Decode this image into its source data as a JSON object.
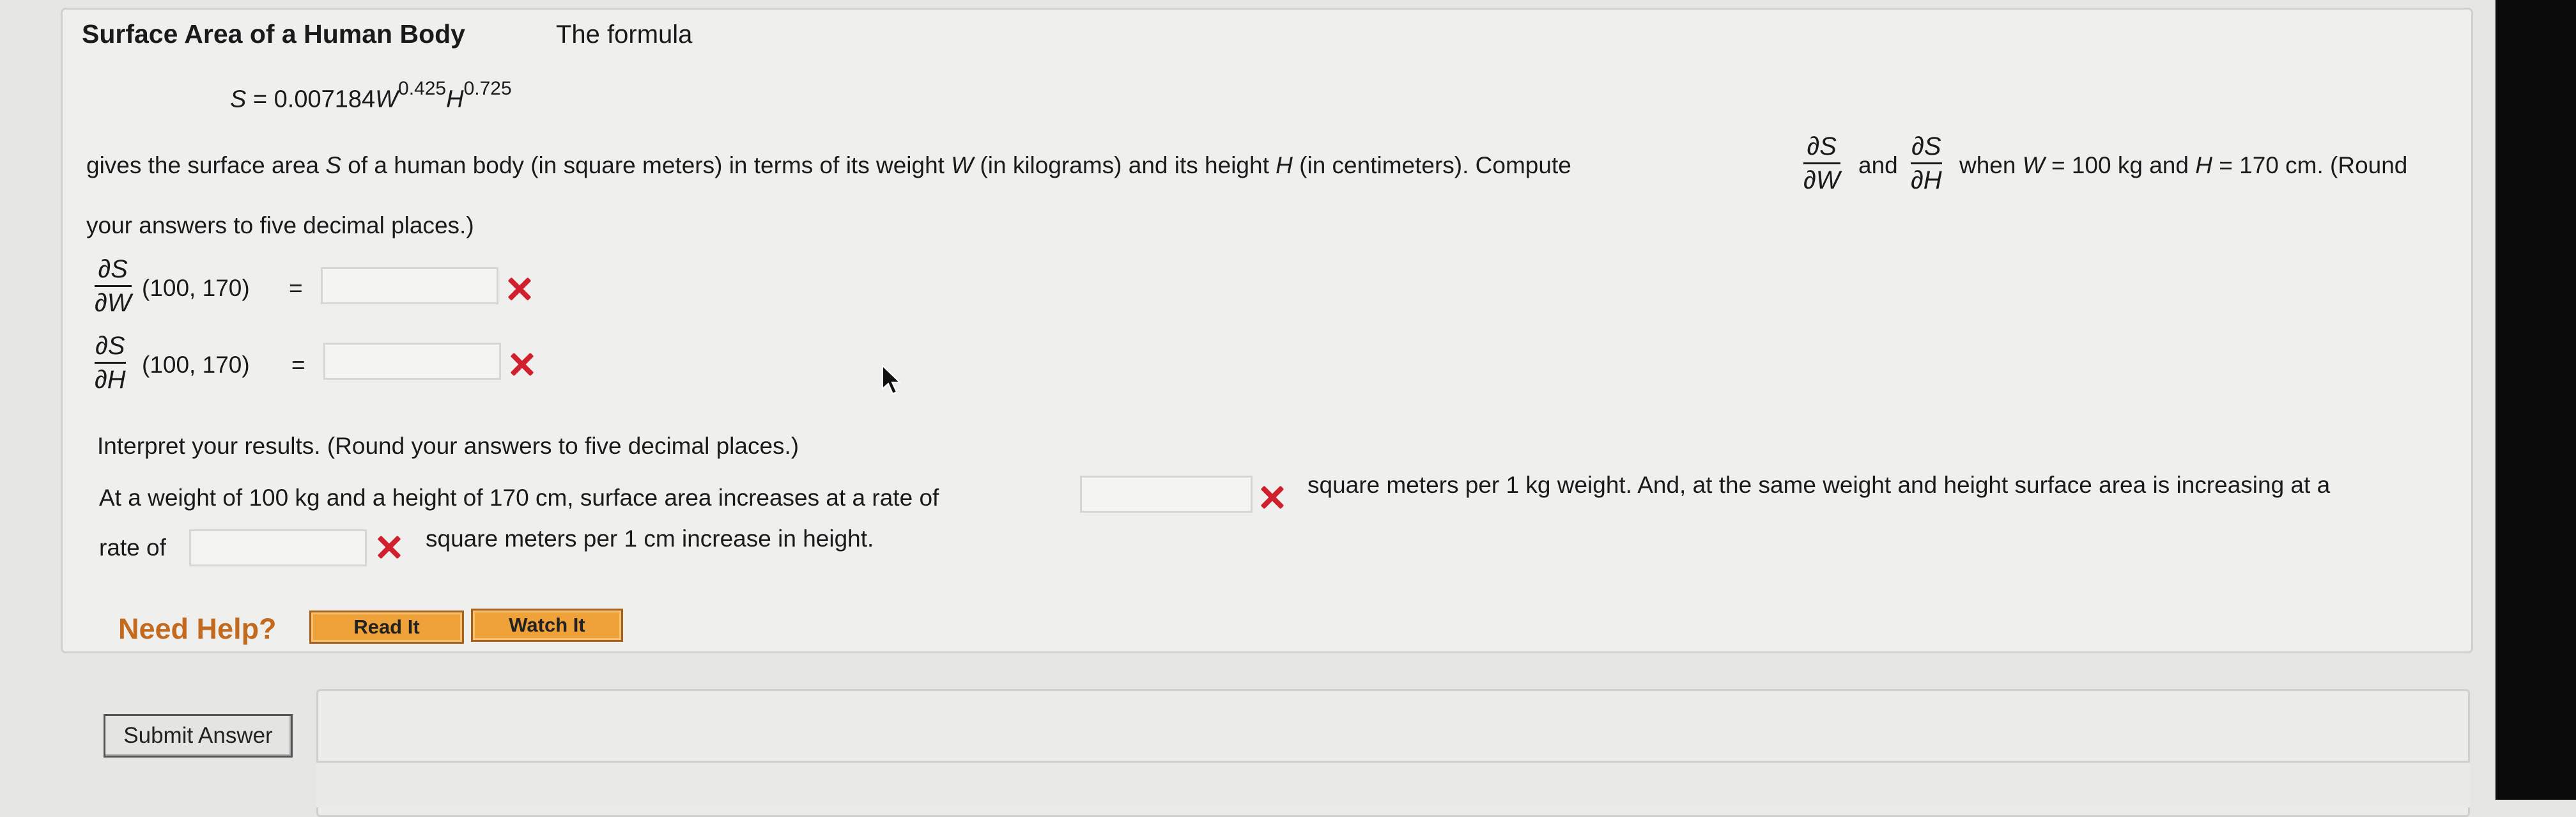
{
  "question": {
    "title": "Surface Area of a Human Body",
    "intro": "The formula",
    "formula": {
      "lhs": "S",
      "equals": " = 0.007184",
      "w": "W",
      "w_exp": "0.425",
      "h": "H",
      "h_exp": "0.725"
    },
    "para1": {
      "part1": "gives the surface area ",
      "s": "S",
      "part2": " of a human body (in square meters) in terms of its weight ",
      "w": "W",
      "part3": " (in kilograms) and its height ",
      "h": "H",
      "part4": " (in centimeters). Compute",
      "and": "and",
      "when": "when ",
      "w2": "W",
      "eq1": " = 100 kg and ",
      "h2": "H",
      "eq2": " = 170 cm. (Round"
    },
    "para1_line2": "your answers to five decimal places.)",
    "partial_num": "∂S",
    "partial_den_w": "∂W",
    "partial_den_h": "∂H",
    "point": "(100, 170)",
    "equals_sign": "="
  },
  "answers": {
    "dsdw_value": "",
    "dsdh_value": "",
    "rate_weight_value": "",
    "rate_height_value": ""
  },
  "interpret": {
    "heading": "Interpret your results. (Round your answers to five decimal places.)",
    "line1_pre": "At a weight of 100 kg and a height of 170 cm, surface area increases at a rate of",
    "line1_post": "square meters per 1 kg weight. And, at the same weight and height surface area is increasing at a",
    "line2_pre": "rate of",
    "line2_post": "square meters per 1 cm increase in height."
  },
  "help": {
    "label": "Need Help?",
    "read_it": "Read It",
    "watch_it": "Watch It"
  },
  "submit_label": "Submit Answer",
  "colors": {
    "incorrect": "#d0202e",
    "help_button": "#f0a23a",
    "need_help_text": "#c46a1e"
  },
  "icons": [
    "incorrect-x-icon",
    "mouse-cursor-icon"
  ]
}
